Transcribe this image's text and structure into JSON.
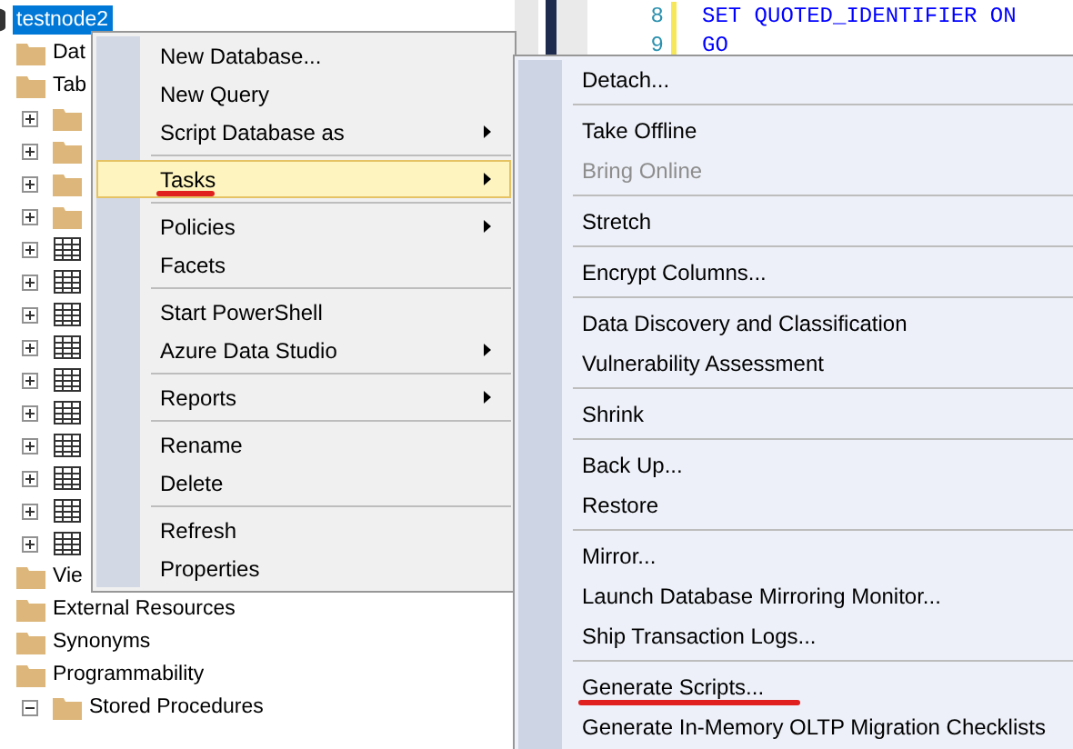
{
  "object_explorer": {
    "tree": [
      {
        "label": "testnode2",
        "kind": "database",
        "selected": true,
        "children": [
          {
            "label": "Dat",
            "kind": "folder",
            "selected": false
          },
          {
            "label": "Tab",
            "kind": "folder",
            "selected": false,
            "children": [
              {
                "kind": "folder",
                "expanded": false
              },
              {
                "kind": "folder",
                "expanded": false
              },
              {
                "kind": "folder",
                "expanded": false
              },
              {
                "kind": "folder",
                "expanded": false
              },
              {
                "kind": "table",
                "expanded": false
              },
              {
                "kind": "table",
                "expanded": false
              },
              {
                "kind": "table",
                "expanded": false
              },
              {
                "kind": "table",
                "expanded": false
              },
              {
                "kind": "table",
                "expanded": false
              },
              {
                "kind": "table",
                "expanded": false
              },
              {
                "kind": "table",
                "expanded": false
              },
              {
                "kind": "table",
                "expanded": false
              },
              {
                "kind": "table",
                "expanded": false
              },
              {
                "kind": "table",
                "expanded": false
              }
            ]
          },
          {
            "label": "Vie",
            "kind": "folder",
            "selected": false
          },
          {
            "label": "External Resources",
            "kind": "folder",
            "selected": false
          },
          {
            "label": "Synonyms",
            "kind": "folder",
            "selected": false
          },
          {
            "label": "Programmability",
            "kind": "folder",
            "selected": false,
            "children": [
              {
                "label": "Stored Procedures",
                "kind": "folder",
                "expanded": true,
                "selected": false
              }
            ]
          }
        ]
      }
    ]
  },
  "editor": {
    "lines": [
      {
        "number": "8",
        "code": "SET QUOTED_IDENTIFIER ON"
      },
      {
        "number": "9",
        "code": "GO"
      }
    ]
  },
  "context_menu": {
    "items": [
      {
        "kind": "item",
        "label": "New Database...",
        "submenu": false,
        "selected": false,
        "disabled": false,
        "marked": false
      },
      {
        "kind": "item",
        "label": "New Query",
        "submenu": false,
        "selected": false,
        "disabled": false,
        "marked": false
      },
      {
        "kind": "item",
        "label": "Script Database as",
        "submenu": true,
        "selected": false,
        "disabled": false,
        "marked": false
      },
      {
        "kind": "separator"
      },
      {
        "kind": "item",
        "label": "Tasks",
        "submenu": true,
        "selected": true,
        "disabled": false,
        "marked": true
      },
      {
        "kind": "separator"
      },
      {
        "kind": "item",
        "label": "Policies",
        "submenu": true,
        "selected": false,
        "disabled": false,
        "marked": false
      },
      {
        "kind": "item",
        "label": "Facets",
        "submenu": false,
        "selected": false,
        "disabled": false,
        "marked": false
      },
      {
        "kind": "separator"
      },
      {
        "kind": "item",
        "label": "Start PowerShell",
        "submenu": false,
        "selected": false,
        "disabled": false,
        "marked": false
      },
      {
        "kind": "item",
        "label": "Azure Data Studio",
        "submenu": true,
        "selected": false,
        "disabled": false,
        "marked": false
      },
      {
        "kind": "separator"
      },
      {
        "kind": "item",
        "label": "Reports",
        "submenu": true,
        "selected": false,
        "disabled": false,
        "marked": false
      },
      {
        "kind": "separator"
      },
      {
        "kind": "item",
        "label": "Rename",
        "submenu": false,
        "selected": false,
        "disabled": false,
        "marked": false
      },
      {
        "kind": "item",
        "label": "Delete",
        "submenu": false,
        "selected": false,
        "disabled": false,
        "marked": false
      },
      {
        "kind": "separator"
      },
      {
        "kind": "item",
        "label": "Refresh",
        "submenu": false,
        "selected": false,
        "disabled": false,
        "marked": false
      },
      {
        "kind": "item",
        "label": "Properties",
        "submenu": false,
        "selected": false,
        "disabled": false,
        "marked": false
      }
    ]
  },
  "tasks_submenu": {
    "items": [
      {
        "kind": "item",
        "label": "Detach...",
        "submenu": false,
        "selected": false,
        "disabled": false,
        "marked": false
      },
      {
        "kind": "separator"
      },
      {
        "kind": "item",
        "label": "Take Offline",
        "submenu": false,
        "selected": false,
        "disabled": false,
        "marked": false
      },
      {
        "kind": "item",
        "label": "Bring Online",
        "submenu": false,
        "selected": false,
        "disabled": true,
        "marked": false
      },
      {
        "kind": "separator"
      },
      {
        "kind": "item",
        "label": "Stretch",
        "submenu": false,
        "selected": false,
        "disabled": false,
        "marked": false
      },
      {
        "kind": "separator"
      },
      {
        "kind": "item",
        "label": "Encrypt Columns...",
        "submenu": false,
        "selected": false,
        "disabled": false,
        "marked": false
      },
      {
        "kind": "separator"
      },
      {
        "kind": "item",
        "label": "Data Discovery and Classification",
        "submenu": false,
        "selected": false,
        "disabled": false,
        "marked": false
      },
      {
        "kind": "item",
        "label": "Vulnerability Assessment",
        "submenu": false,
        "selected": false,
        "disabled": false,
        "marked": false
      },
      {
        "kind": "separator"
      },
      {
        "kind": "item",
        "label": "Shrink",
        "submenu": false,
        "selected": false,
        "disabled": false,
        "marked": false
      },
      {
        "kind": "separator"
      },
      {
        "kind": "item",
        "label": "Back Up...",
        "submenu": false,
        "selected": false,
        "disabled": false,
        "marked": false
      },
      {
        "kind": "item",
        "label": "Restore",
        "submenu": false,
        "selected": false,
        "disabled": false,
        "marked": false
      },
      {
        "kind": "separator"
      },
      {
        "kind": "item",
        "label": "Mirror...",
        "submenu": false,
        "selected": false,
        "disabled": false,
        "marked": false
      },
      {
        "kind": "item",
        "label": "Launch Database Mirroring Monitor...",
        "submenu": false,
        "selected": false,
        "disabled": false,
        "marked": false
      },
      {
        "kind": "item",
        "label": "Ship Transaction Logs...",
        "submenu": false,
        "selected": false,
        "disabled": false,
        "marked": false
      },
      {
        "kind": "separator"
      },
      {
        "kind": "item",
        "label": "Generate Scripts...",
        "submenu": false,
        "selected": false,
        "disabled": false,
        "marked": true
      },
      {
        "kind": "item",
        "label": "Generate In-Memory OLTP Migration Checklists",
        "submenu": false,
        "selected": false,
        "disabled": false,
        "marked": false
      }
    ]
  }
}
